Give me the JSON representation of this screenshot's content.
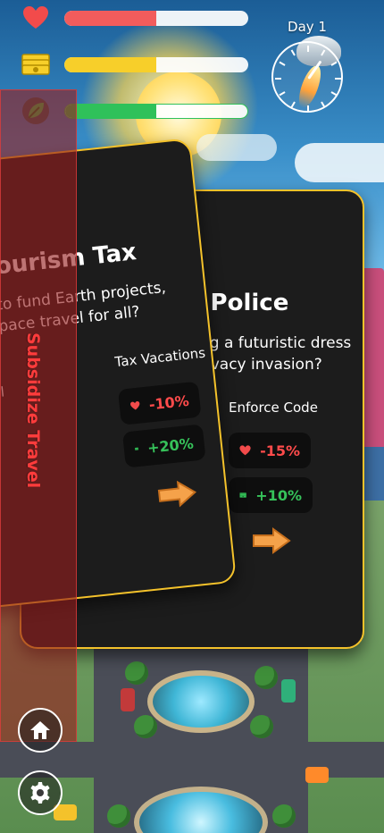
{
  "hud": {
    "health": {
      "level": 0.5,
      "color": "#f25c5c"
    },
    "money": {
      "level": 0.5,
      "color": "#f7cf2a"
    },
    "environment": {
      "level": 0.5,
      "color": "#2fc15a"
    },
    "day_label": "Day 1",
    "icons": [
      "heart-icon",
      "money-icon",
      "leaf-icon",
      "clock-icon"
    ]
  },
  "card_front": {
    "title": "Tourism Tax",
    "description_line1": "ns to fund Earth projects,",
    "description_line2": "e space travel for all?",
    "left_choice_fragment": "el",
    "right_choice": {
      "label": "Tax Vacations",
      "health_effect": "-10%",
      "money_effect": "+20%"
    }
  },
  "card_back": {
    "title": "n Police",
    "description_line1": "ng a futuristic dress",
    "description_line2": "rivacy invasion?",
    "right_choice": {
      "label": "Enforce Code",
      "health_effect": "-15%",
      "money_effect": "+10%"
    }
  },
  "overlay": {
    "label": "Subsidize Travel"
  },
  "colors": {
    "card_border": "#f4c22b",
    "card_bg": "#1c1c1c",
    "negative": "#ff4b4b",
    "positive": "#36c25a",
    "arrow": "#f5a24a"
  },
  "buttons": {
    "home": "home-icon",
    "settings": "gear-icon"
  }
}
